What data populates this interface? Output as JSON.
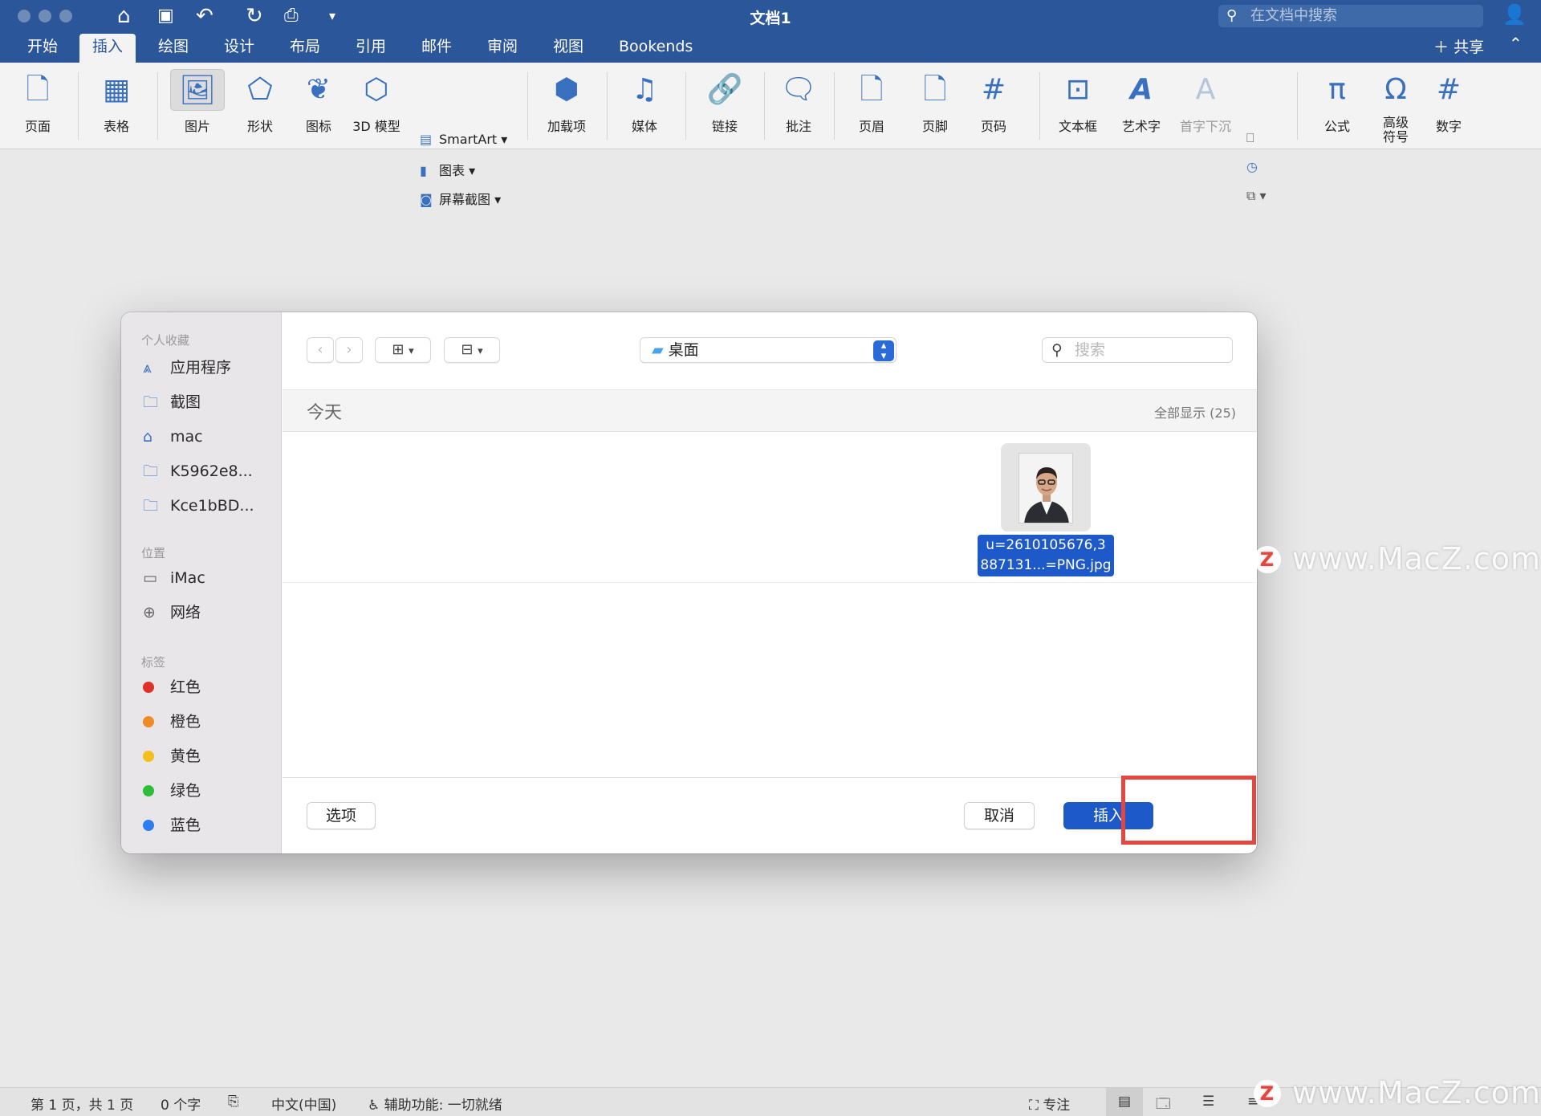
{
  "window": {
    "title": "文档1",
    "search_placeholder": "在文档中搜索",
    "share_label": "共享"
  },
  "tabs": [
    "开始",
    "插入",
    "绘图",
    "设计",
    "布局",
    "引用",
    "邮件",
    "审阅",
    "视图",
    "Bookends"
  ],
  "active_tab": "插入",
  "ribbon": {
    "pages": "页面",
    "table": "表格",
    "pictures": "图片",
    "shapes": "形状",
    "icons": "图标",
    "models_3d": "3D 模型",
    "smartart": "SmartArt",
    "chart": "图表",
    "screenshot": "屏幕截图",
    "addins": "加载项",
    "media": "媒体",
    "link": "链接",
    "comment": "批注",
    "header": "页眉",
    "footer": "页脚",
    "page_number": "页码",
    "textbox": "文本框",
    "wordart": "艺术字",
    "dropcap": "首字下沉",
    "equation": "公式",
    "symbol": "高级符号",
    "number": "数字"
  },
  "dialog": {
    "sidebar": {
      "favorites_header": "个人收藏",
      "favorites": [
        "应用程序",
        "截图",
        "mac",
        "K5962e8...",
        "Kce1bBD..."
      ],
      "locations_header": "位置",
      "locations": [
        "iMac",
        "网络"
      ],
      "tags_header": "标签",
      "tags": [
        {
          "label": "红色",
          "color": "#e0302a"
        },
        {
          "label": "橙色",
          "color": "#f08a24"
        },
        {
          "label": "黄色",
          "color": "#f5be1c"
        },
        {
          "label": "绿色",
          "color": "#2ebd39"
        },
        {
          "label": "蓝色",
          "color": "#2d7cf0"
        }
      ]
    },
    "location": "桌面",
    "search_placeholder": "搜索",
    "section_title": "今天",
    "show_all": "全部显示 (25)",
    "selected_file": {
      "name_line1": "u=2610105676,3",
      "name_line2": "887131...=PNG.jpg"
    },
    "options_label": "选项",
    "cancel_label": "取消",
    "insert_label": "插入"
  },
  "statusbar": {
    "page": "第 1 页，共 1 页",
    "words": "0 个字",
    "language": "中文(中国)",
    "accessibility": "辅助功能: 一切就绪",
    "focus": "专注"
  },
  "watermark": "www.MacZ.com",
  "colors": {
    "brand": "#2b579a",
    "accent": "#1d59c9",
    "highlight": "#e4473f"
  }
}
